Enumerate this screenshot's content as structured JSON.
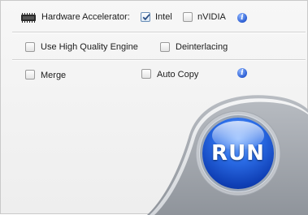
{
  "hardware": {
    "label": "Hardware Accelerator:",
    "chip_icon": "chip-icon",
    "options": [
      {
        "label": "Intel",
        "checked": true
      },
      {
        "label": "nVIDIA",
        "checked": false
      }
    ],
    "info_glyph": "i"
  },
  "engine": {
    "use_high_quality": {
      "label": "Use High Quality Engine",
      "checked": false
    },
    "deinterlacing": {
      "label": "Deinterlacing",
      "checked": false
    }
  },
  "output": {
    "merge": {
      "label": "Merge",
      "checked": false
    },
    "auto_copy": {
      "label": "Auto Copy",
      "checked": false
    },
    "info_glyph": "i"
  },
  "run": {
    "label": "RUN"
  },
  "colors": {
    "accent": "#2c6ee8",
    "panel": "#f2f2f2",
    "run_dark": "#0f3fb5"
  }
}
